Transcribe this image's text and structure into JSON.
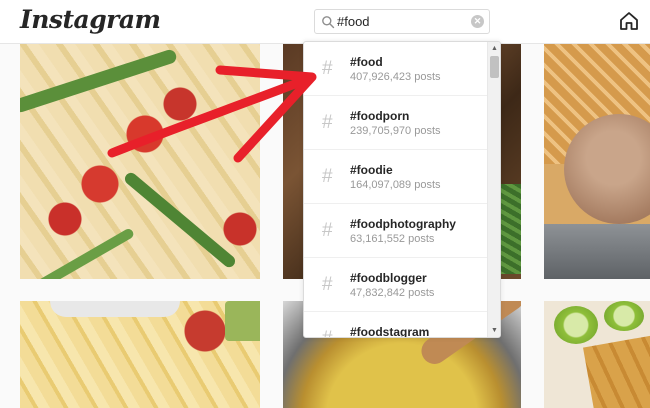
{
  "app": {
    "logo": "Instagram"
  },
  "search": {
    "query": "#food",
    "clear_icon": "clear-icon",
    "search_icon": "search-icon"
  },
  "nav": {
    "home_icon": "home-icon"
  },
  "suggestions": {
    "hash_symbol": "#",
    "items": [
      {
        "tag": "#food",
        "count": "407,926,423 posts"
      },
      {
        "tag": "#foodporn",
        "count": "239,705,970 posts"
      },
      {
        "tag": "#foodie",
        "count": "164,097,089 posts"
      },
      {
        "tag": "#foodphotography",
        "count": "63,161,552 posts"
      },
      {
        "tag": "#foodblogger",
        "count": "47,832,842 posts"
      },
      {
        "tag": "#foodstagram",
        "count": ""
      }
    ]
  },
  "colors": {
    "annotation_arrow": "#e8202a",
    "text_primary": "#262626",
    "text_secondary": "#999999"
  }
}
